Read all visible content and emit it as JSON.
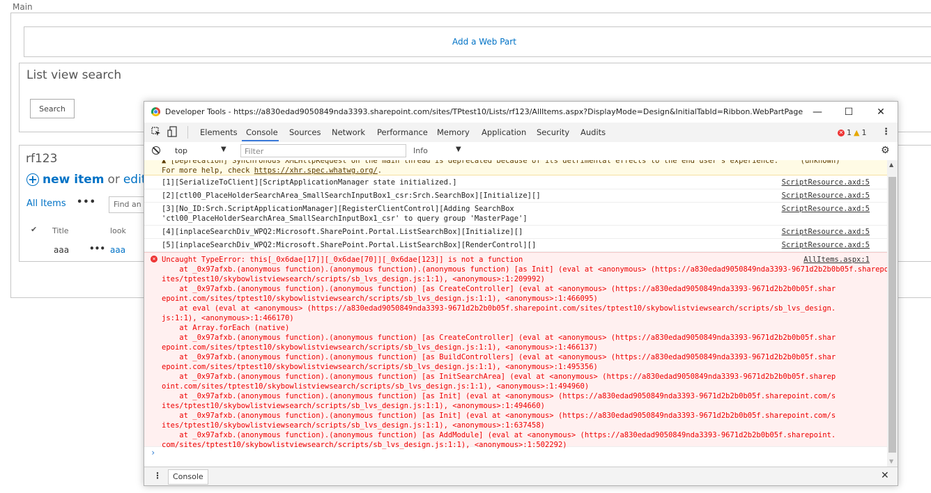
{
  "sharepoint": {
    "zone_label": "Main",
    "add_webpart": "Add a Web Part",
    "lvs_title": "List view search",
    "search_button": "Search",
    "list_title": "rf123",
    "new_item": "new item",
    "or_text": "or",
    "edit_text": "edit",
    "all_items": "All Items",
    "more": "•••",
    "find_placeholder": "Find an i",
    "col_check": "✔",
    "col_title": "Title",
    "col_look": "look",
    "row_title": "aaa",
    "row_more": "•••",
    "row_look": "aaa"
  },
  "devtools": {
    "title": "Developer Tools - https://a830edad9050849nda3393.sharepoint.com/sites/TPtest10/Lists/rf123/AllItems.aspx?DisplayMode=Design&InitialTabId=Ribbon.WebPartPage",
    "tabs": [
      "Elements",
      "Console",
      "Sources",
      "Network",
      "Performance",
      "Memory",
      "Application",
      "Security",
      "Audits"
    ],
    "error_count": "1",
    "warning_count": "1",
    "context": "top",
    "filter_placeholder": "Filter",
    "level": "Info",
    "drawer_tab": "Console",
    "warning_line1": "▲ [Deprecation] Synchronous XMLHttpRequest on the main thread is deprecated because of its detrimental effects to the end user's experience.     (unknown)",
    "warning_line2_prefix": "For more help, check ",
    "warning_link": "https://xhr.spec.whatwg.org/",
    "warning_line2_suffix": ".",
    "messages": [
      {
        "text": "[1][SerializeToClient][ScriptApplicationManager state initialized.]",
        "source": "ScriptResource.axd:5"
      },
      {
        "text": "[2][ctl00_PlaceHolderSearchArea_SmallSearchInputBox1_csr:Srch.SearchBox][Initialize][]",
        "source": "ScriptResource.axd:5"
      },
      {
        "text": "[3][No_ID:Srch.ScriptApplicationManager][RegisterClientControl][Adding SearchBox\n'ctl00_PlaceHolderSearchArea_SmallSearchInputBox1_csr' to query group 'MasterPage']",
        "source": "ScriptResource.axd:5"
      },
      {
        "text": "[4][inplaceSearchDiv_WPQ2:Microsoft.SharePoint.Portal.ListSearchBox][Initialize][]",
        "source": "ScriptResource.axd:5"
      },
      {
        "text": "[5][inplaceSearchDiv_WPQ2:Microsoft.SharePoint.Portal.ListSearchBox][RenderControl][]",
        "source": "ScriptResource.axd:5"
      }
    ],
    "error": {
      "text": "Uncaught TypeError: this[_0x6dae[17]][_0x6dae[70]][_0x6dae[123]] is not a function\n    at _0x97afxb.(anonymous function).(anonymous function).(anonymous function) [as Init] (eval at <anonymous> (https://a830edad9050849nda3393-9671d2b2b0b05f.sharepoint.com/s\nites/tptest10/skybowlistviewsearch/scripts/sb_lvs_design.js:1:1), <anonymous>:1:209992)\n    at _0x97afxb.(anonymous function).(anonymous function) [as CreateController] (eval at <anonymous> (https://a830edad9050849nda3393-9671d2b2b0b05f.shar\nepoint.com/sites/tptest10/skybowlistviewsearch/scripts/sb_lvs_design.js:1:1), <anonymous>:1:466095)\n    at eval (eval at <anonymous> (https://a830edad9050849nda3393-9671d2b2b0b05f.sharepoint.com/sites/tptest10/skybowlistviewsearch/scripts/sb_lvs_design.\njs:1:1), <anonymous>:1:466170)\n    at Array.forEach (native)\n    at _0x97afxb.(anonymous function).(anonymous function) [as CreateController] (eval at <anonymous> (https://a830edad9050849nda3393-9671d2b2b0b05f.shar\nepoint.com/sites/tptest10/skybowlistviewsearch/scripts/sb_lvs_design.js:1:1), <anonymous>:1:466137)\n    at _0x97afxb.(anonymous function).(anonymous function) [as BuildControllers] (eval at <anonymous> (https://a830edad9050849nda3393-9671d2b2b0b05f.shar\nepoint.com/sites/tptest10/skybowlistviewsearch/scripts/sb_lvs_design.js:1:1), <anonymous>:1:495356)\n    at _0x97afxb.(anonymous function).(anonymous function) [as InitSearchArea] (eval at <anonymous> (https://a830edad9050849nda3393-9671d2b2b0b05f.sharep\noint.com/sites/tptest10/skybowlistviewsearch/scripts/sb_lvs_design.js:1:1), <anonymous>:1:494960)\n    at _0x97afxb.(anonymous function).(anonymous function) [as Init] (eval at <anonymous> (https://a830edad9050849nda3393-9671d2b2b0b05f.sharepoint.com/s\nites/tptest10/skybowlistviewsearch/scripts/sb_lvs_design.js:1:1), <anonymous>:1:494660)\n    at _0x97afxb.(anonymous function).(anonymous function) [as Init] (eval at <anonymous> (https://a830edad9050849nda3393-9671d2b2b0b05f.sharepoint.com/s\nites/tptest10/skybowlistviewsearch/scripts/sb_lvs_design.js:1:1), <anonymous>:1:637458)\n    at _0x97afxb.(anonymous function).(anonymous function) [as AddModule] (eval at <anonymous> (https://a830edad9050849nda3393-9671d2b2b0b05f.sharepoint.\ncom/sites/tptest10/skybowlistviewsearch/scripts/sb_lvs_design.js:1:1), <anonymous>:1:502292)",
      "source": "AllItems.aspx:1"
    },
    "prompt": "›"
  },
  "colors": {
    "accent": "#0072c6",
    "error": "#ee0000",
    "devtools_tab_active": "#3879d9"
  },
  "icons": {
    "chrome": "chrome-icon",
    "inspect": "inspect-icon",
    "device": "device-toolbar-icon",
    "clear": "clear-console-icon",
    "settings": "gear-icon",
    "close": "close-icon"
  }
}
